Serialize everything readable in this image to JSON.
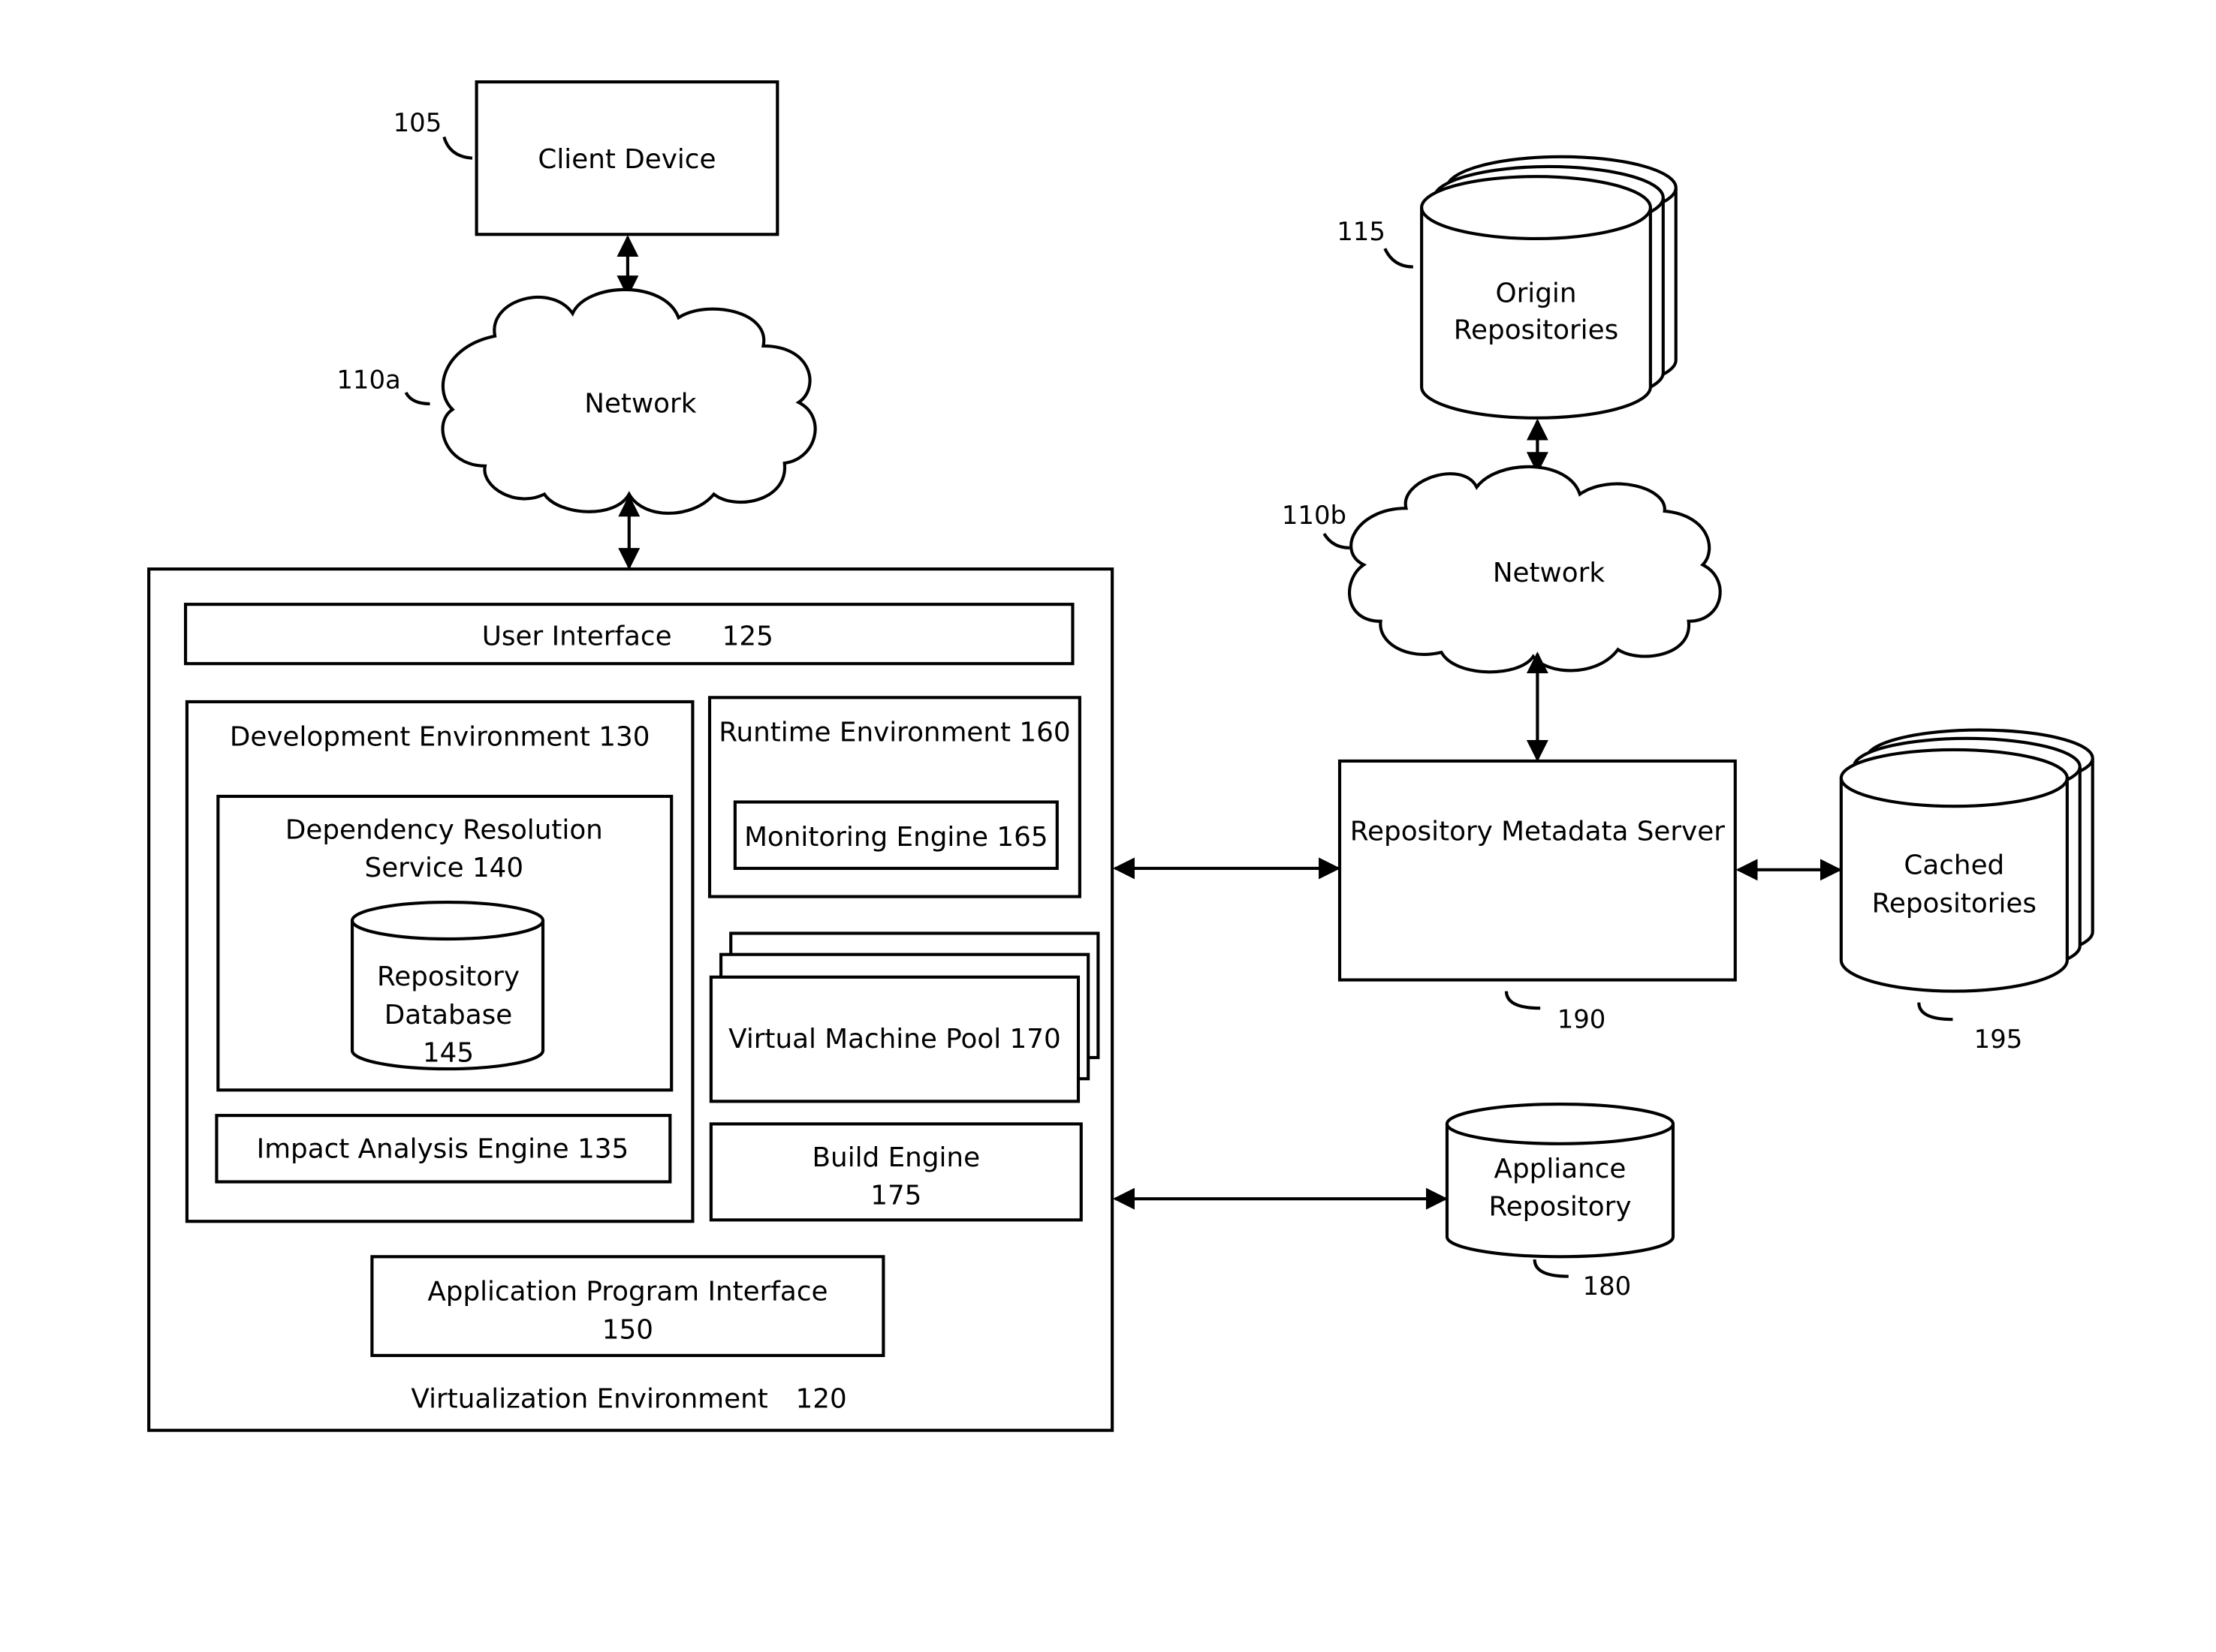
{
  "diagram": {
    "client_device": {
      "label": "Client Device",
      "ref": "105"
    },
    "network_a": {
      "label": "Network",
      "ref": "110a"
    },
    "network_b": {
      "label": "Network",
      "ref": "110b"
    },
    "origin_repositories": {
      "label_line1": "Origin",
      "label_line2": "Repositories",
      "ref": "115"
    },
    "virtualization_environment": {
      "label": "Virtualization Environment",
      "ref": "120",
      "user_interface": {
        "label": "User Interface",
        "ref": "125"
      },
      "development_environment": {
        "label": "Development Environment 130",
        "dependency_resolution_service": {
          "label_line1": "Dependency Resolution",
          "label_line2": "Service 140"
        },
        "repository_database": {
          "label_line1": "Repository",
          "label_line2": "Database",
          "label_line3": "145"
        },
        "impact_analysis_engine": {
          "label": "Impact Analysis Engine 135"
        }
      },
      "runtime_environment": {
        "label": "Runtime Environment 160",
        "monitoring_engine": {
          "label": "Monitoring Engine 165"
        }
      },
      "virtual_machine_pool": {
        "label": "Virtual Machine Pool 170"
      },
      "build_engine": {
        "label_line1": "Build Engine",
        "label_line2": "175"
      },
      "application_program_interface": {
        "label_line1": "Application Program Interface",
        "label_line2": "150"
      }
    },
    "repository_metadata_server": {
      "label": "Repository Metadata Server",
      "ref": "190"
    },
    "cached_repositories": {
      "label_line1": "Cached",
      "label_line2": "Repositories",
      "ref": "195"
    },
    "appliance_repository": {
      "label_line1": "Appliance",
      "label_line2": "Repository",
      "ref": "180"
    }
  }
}
